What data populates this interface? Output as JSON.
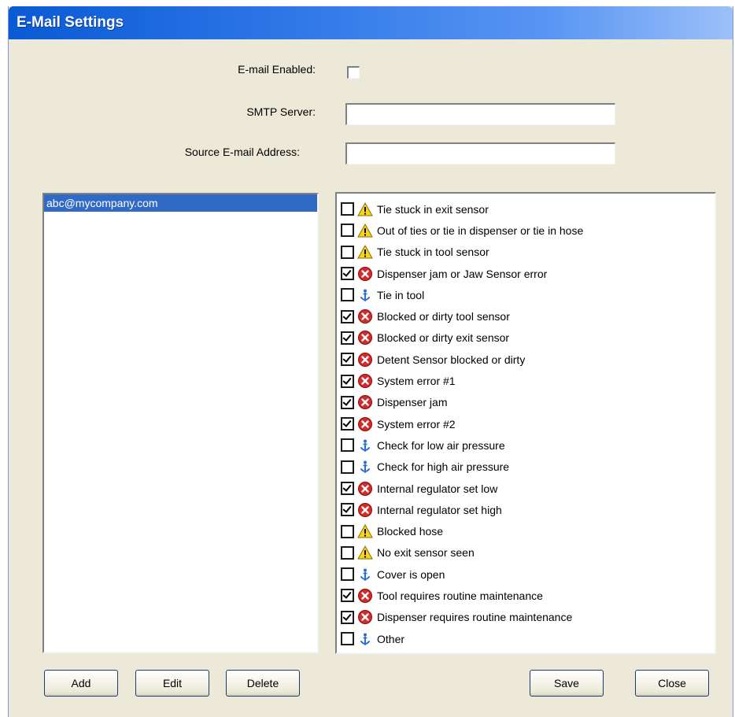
{
  "window": {
    "title": "E-Mail Settings"
  },
  "form": {
    "email_enabled_label": "E-mail Enabled:",
    "email_enabled_checked": false,
    "smtp_label": "SMTP Server:",
    "smtp_value": "",
    "source_label": "Source E-mail Address:",
    "source_value": ""
  },
  "recipients": {
    "items": [
      "abc@mycompany.com"
    ],
    "selected_index": 0
  },
  "alerts": [
    {
      "label": "Tie stuck in exit sensor",
      "checked": false,
      "icon": "warning-icon"
    },
    {
      "label": "Out of ties or tie in dispenser or tie in hose",
      "checked": false,
      "icon": "warning-icon"
    },
    {
      "label": "Tie stuck in tool sensor",
      "checked": false,
      "icon": "warning-icon"
    },
    {
      "label": "Dispenser jam or Jaw Sensor error",
      "checked": true,
      "icon": "error-icon"
    },
    {
      "label": "Tie in tool",
      "checked": false,
      "icon": "info-icon"
    },
    {
      "label": "Blocked or dirty tool sensor",
      "checked": true,
      "icon": "error-icon"
    },
    {
      "label": "Blocked or dirty exit sensor",
      "checked": true,
      "icon": "error-icon"
    },
    {
      "label": "Detent Sensor blocked or dirty",
      "checked": true,
      "icon": "error-icon"
    },
    {
      "label": "System error #1",
      "checked": true,
      "icon": "error-icon"
    },
    {
      "label": "Dispenser jam",
      "checked": true,
      "icon": "error-icon"
    },
    {
      "label": "System error #2",
      "checked": true,
      "icon": "error-icon"
    },
    {
      "label": "Check for low air pressure",
      "checked": false,
      "icon": "info-icon"
    },
    {
      "label": "Check for high air pressure",
      "checked": false,
      "icon": "info-icon"
    },
    {
      "label": "Internal regulator set low",
      "checked": true,
      "icon": "error-icon"
    },
    {
      "label": "Internal regulator set high",
      "checked": true,
      "icon": "error-icon"
    },
    {
      "label": "Blocked hose",
      "checked": false,
      "icon": "warning-icon"
    },
    {
      "label": "No exit sensor seen",
      "checked": false,
      "icon": "warning-icon"
    },
    {
      "label": "Cover is open",
      "checked": false,
      "icon": "info-icon"
    },
    {
      "label": "Tool requires routine maintenance",
      "checked": true,
      "icon": "error-icon"
    },
    {
      "label": "Dispenser requires routine maintenance",
      "checked": true,
      "icon": "error-icon"
    },
    {
      "label": "Other",
      "checked": false,
      "icon": "info-icon"
    }
  ],
  "buttons": {
    "add": "Add",
    "edit": "Edit",
    "delete": "Delete",
    "save": "Save",
    "close": "Close"
  },
  "colors": {
    "titlebar": "#0A5AD3",
    "window_bg": "#ECE9D8",
    "selection": "#316AC5"
  }
}
